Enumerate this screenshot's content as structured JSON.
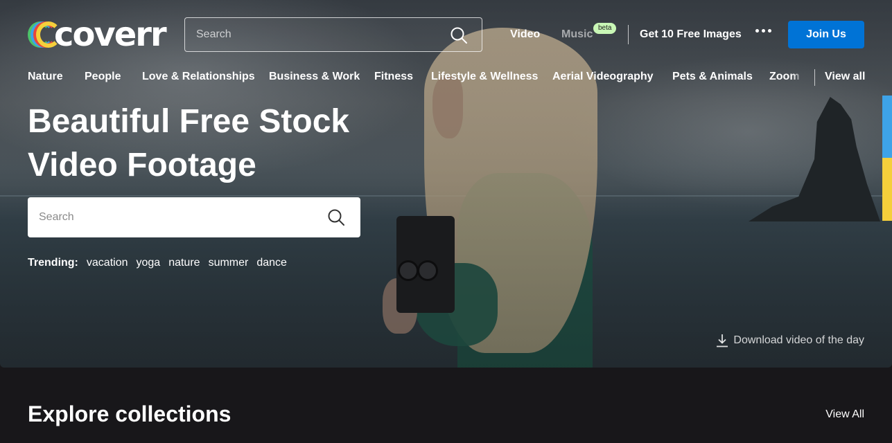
{
  "header": {
    "logo_text": "coverr",
    "search_placeholder": "Search",
    "nav": {
      "video": "Video",
      "music": "Music",
      "beta": "beta",
      "free_images": "Get 10 Free Images",
      "join": "Join Us"
    }
  },
  "categories": [
    "Nature",
    "People",
    "Love & Relationships",
    "Business & Work",
    "Fitness",
    "Lifestyle & Wellness",
    "Aerial Videography",
    "Pets & Animals",
    "Zoom Backgrounds"
  ],
  "categories_view_all": "View all",
  "hero": {
    "headline_line1": "Beautiful Free Stock",
    "headline_line2": "Video Footage",
    "search_placeholder": "Search",
    "trending_label": "Trending:",
    "trending_tags": [
      "vacation",
      "yoga",
      "nature",
      "summer",
      "dance"
    ],
    "download_label": "Download video of the day"
  },
  "collections": {
    "title": "Explore collections",
    "view_all": "View All"
  },
  "colors": {
    "accent_blue": "#0073d6",
    "beta_badge": "#c9f7b6",
    "logo_rainbow": [
      "#f5cf3b",
      "#e8453c",
      "#3ea3e8",
      "#4cc36b"
    ]
  },
  "icons": [
    "search-icon",
    "more-dots-icon",
    "download-icon",
    "coverr-logo-mark"
  ]
}
